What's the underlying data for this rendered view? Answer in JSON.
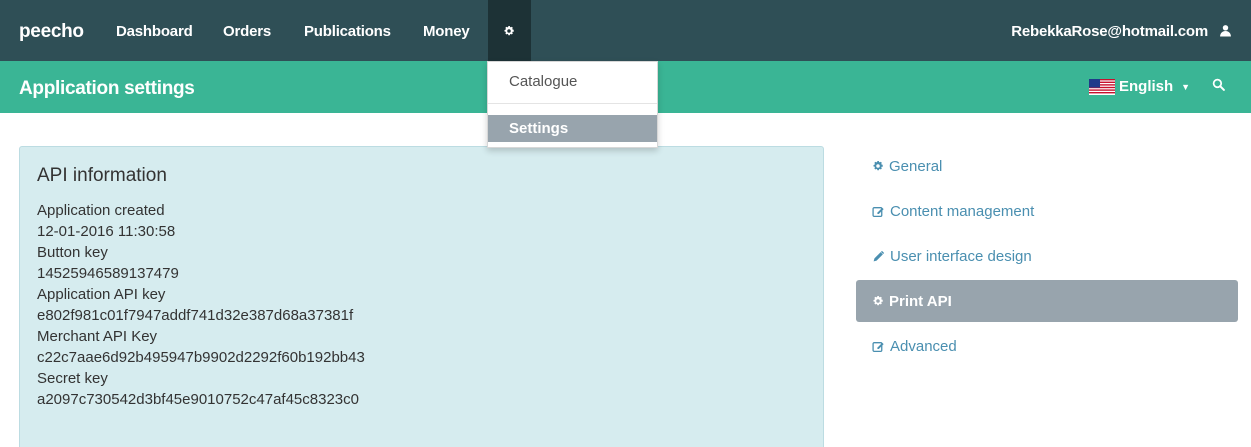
{
  "navbar": {
    "brand": "peecho",
    "items": [
      "Dashboard",
      "Orders",
      "Publications",
      "Money"
    ],
    "settings_icon": "gear-icon",
    "user_email": "RebekkaRose@hotmail.com",
    "user_icon": "user-icon",
    "background": "#2f4f56"
  },
  "subbar": {
    "title": "Application settings",
    "language": "English",
    "language_icon": "us-flag-icon",
    "search_icon": "search-icon",
    "background": "#3ab595"
  },
  "dropdown": {
    "items": [
      "Catalogue",
      "Settings"
    ],
    "selected": "Settings"
  },
  "api_info": {
    "title": "API information",
    "fields": [
      {
        "label": "Application created",
        "value": "12-01-2016 11:30:58"
      },
      {
        "label": "Button key",
        "value": "14525946589137479"
      },
      {
        "label": "Application API key",
        "value": "e802f981c01f7947addf741d32e387d68a37381f"
      },
      {
        "label": "Merchant API Key",
        "value": "c22c7aae6d92b495947b9902d2292f60b192bb43"
      },
      {
        "label": "Secret key",
        "value": "a2097c730542d3bf45e9010752c47af45c8323c0"
      }
    ]
  },
  "side_menu": {
    "items": [
      {
        "label": "General",
        "icon": "gear-icon"
      },
      {
        "label": "Content management",
        "icon": "edit-icon"
      },
      {
        "label": "User interface design",
        "icon": "pencil-icon"
      },
      {
        "label": "Print API",
        "icon": "gear-icon"
      },
      {
        "label": "Advanced",
        "icon": "edit-icon"
      }
    ],
    "active": "Print API"
  }
}
